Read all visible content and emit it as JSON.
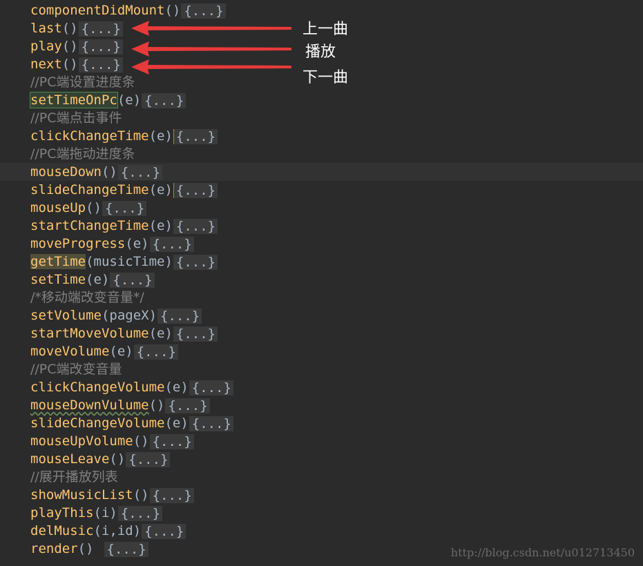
{
  "editor": {
    "lines": [
      {
        "kind": "method",
        "name": "componentDidMount",
        "params": "()",
        "fold": "{...}"
      },
      {
        "kind": "method",
        "name": "last",
        "params": "()",
        "fold": "{...}"
      },
      {
        "kind": "method",
        "name": "play",
        "params": "()",
        "fold": "{...}"
      },
      {
        "kind": "method",
        "name": "next",
        "params": "()",
        "fold": "{...}"
      },
      {
        "kind": "comment",
        "text": "//PC端设置进度条"
      },
      {
        "kind": "method",
        "name": "setTimeOnPc",
        "params": "(e)",
        "fold": "{...}",
        "highlight": "green"
      },
      {
        "kind": "comment",
        "text": "//PC端点击事件"
      },
      {
        "kind": "method",
        "name": "clickChangeTime",
        "params": "(e)",
        "fold": "{...}",
        "caret": true
      },
      {
        "kind": "comment",
        "text": "//PC端拖动进度条"
      },
      {
        "kind": "method",
        "name": "mouseDown",
        "params": "()",
        "fold": "{...}",
        "current": true
      },
      {
        "kind": "method",
        "name": "slideChangeTime",
        "params": "(e)",
        "fold": "{...}",
        "caret": true
      },
      {
        "kind": "method",
        "name": "mouseUp",
        "params": "()",
        "fold": "{...}"
      },
      {
        "kind": "method",
        "name": "startChangeTime",
        "params": "(e)",
        "fold": "{...}"
      },
      {
        "kind": "method",
        "name": "moveProgress",
        "params": "(e)",
        "fold": "{...}"
      },
      {
        "kind": "method",
        "name": "getTime",
        "params": "(musicTime)",
        "fold": "{...}",
        "highlight": "yellow"
      },
      {
        "kind": "method",
        "name": "setTime",
        "params": "(e)",
        "fold": "{...}"
      },
      {
        "kind": "comment",
        "text": "/*移动端改变音量*/"
      },
      {
        "kind": "method",
        "name": "setVolume",
        "params": "(pageX)",
        "fold": "{...}"
      },
      {
        "kind": "method",
        "name": "startMoveVolume",
        "params": "(e)",
        "fold": "{...}"
      },
      {
        "kind": "method",
        "name": "moveVolume",
        "params": "(e)",
        "fold": "{...}"
      },
      {
        "kind": "comment",
        "text": "//PC端改变音量"
      },
      {
        "kind": "method",
        "name": "clickChangeVolume",
        "params": "(e)",
        "fold": "{...}"
      },
      {
        "kind": "method",
        "name": "mouseDownVulume",
        "params": "()",
        "fold": "{...}",
        "squiggle": true
      },
      {
        "kind": "method",
        "name": "slideChangeVolume",
        "params": "(e)",
        "fold": "{...}"
      },
      {
        "kind": "method",
        "name": "mouseUpVolume",
        "params": "()",
        "fold": "{...}"
      },
      {
        "kind": "method",
        "name": "mouseLeave",
        "params": "()",
        "fold": "{...}"
      },
      {
        "kind": "comment",
        "text": "//展开播放列表"
      },
      {
        "kind": "method",
        "name": "showMusicList",
        "params": "()",
        "fold": "{...}"
      },
      {
        "kind": "method",
        "name": "playThis",
        "params": "(i)",
        "fold": "{...}"
      },
      {
        "kind": "method",
        "name": "delMusic",
        "params": "(i,id)",
        "fold": "{...}"
      },
      {
        "kind": "method",
        "name": "render",
        "params": "()",
        "fold": "{...}",
        "gap": true
      }
    ]
  },
  "annotations": {
    "last_label": "上一曲",
    "play_label": "播放",
    "next_label": "下一曲",
    "arrow_color": "#e83a3a"
  },
  "watermark": "http://blog.csdn.net/u012713450",
  "colors": {
    "background": "#2b2b2b",
    "method": "#ffc66d",
    "comment": "#808080",
    "params": "#a9b7c6"
  }
}
